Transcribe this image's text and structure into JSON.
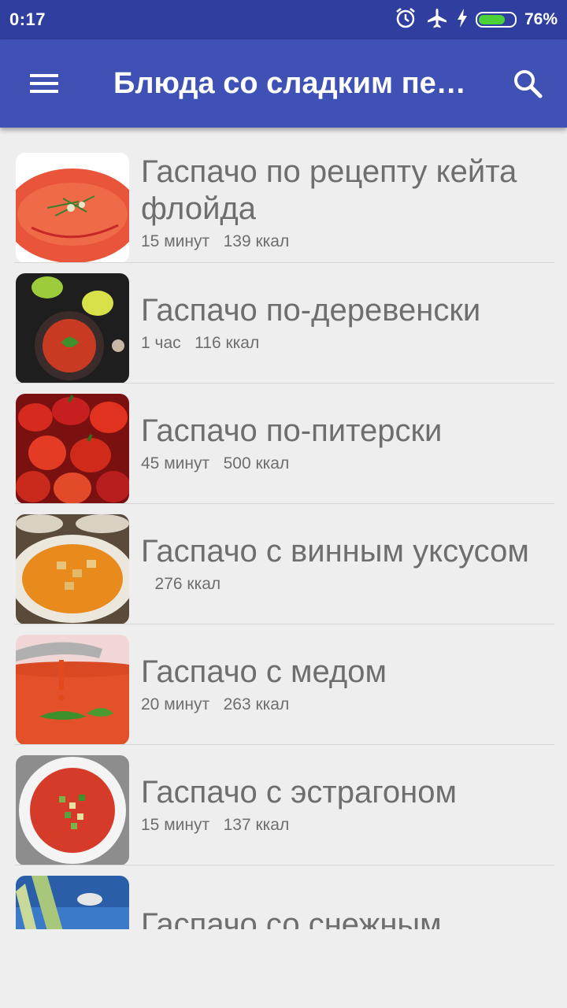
{
  "status_bar": {
    "time": "0:17",
    "battery": "76%",
    "battery_level": 0.76
  },
  "app_bar": {
    "title": "Блюда со сладким пер…"
  },
  "recipes": [
    {
      "name": "Гаспачо по рецепту кейта флойда",
      "time": "15 минут",
      "kcal": "139 ккал"
    },
    {
      "name": "Гаспачо по-деревенски",
      "time": "1 час",
      "kcal": "116 ккал"
    },
    {
      "name": "Гаспачо по-питерски",
      "time": "45 минут",
      "kcal": "500 ккал"
    },
    {
      "name": "Гаспачо с винным уксусом",
      "time": "",
      "kcal": "276 ккал"
    },
    {
      "name": "Гаспачо с медом",
      "time": "20 минут",
      "kcal": "263 ккал"
    },
    {
      "name": "Гаспачо с эстрагоном",
      "time": "15 минут",
      "kcal": "137 ккал"
    },
    {
      "name": "Гаспачо со снежным",
      "time": "",
      "kcal": ""
    }
  ],
  "icons": {
    "menu": "hamburger-icon",
    "search": "search-icon",
    "alarm": "alarm-icon",
    "airplane": "airplane-mode-icon",
    "charging": "charging-icon"
  },
  "colors": {
    "app_bar": "#3f51b5",
    "status_bar": "#303f9f",
    "background": "#eeeeee",
    "text": "#6e6e6e"
  }
}
